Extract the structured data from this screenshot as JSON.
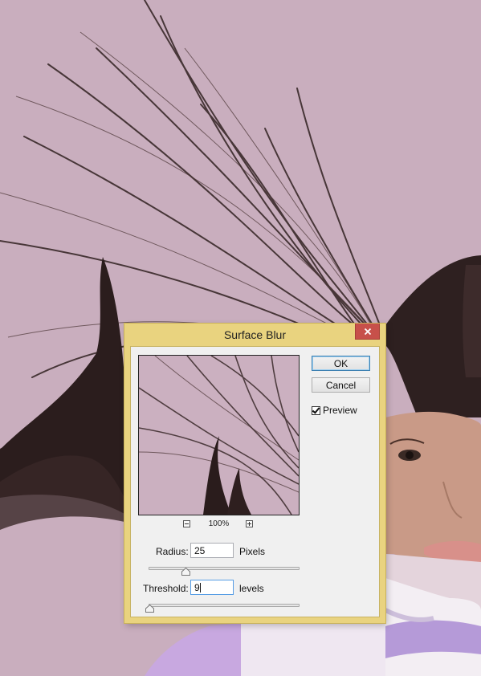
{
  "dialog": {
    "title": "Surface Blur",
    "close_icon": "close-icon",
    "ok_label": "OK",
    "cancel_label": "Cancel",
    "preview_label": "Preview",
    "preview_checked": true,
    "zoom_level": "100%",
    "radius": {
      "label": "Radius:",
      "value": "25",
      "unit": "Pixels",
      "slider_fraction": 0.24
    },
    "threshold": {
      "label": "Threshold:",
      "value": "9",
      "unit": "levels",
      "slider_fraction": 0.0
    }
  },
  "colors": {
    "title_bar": "#e9d37f",
    "close_button": "#c7504a",
    "background": "#c9aebe",
    "hair": "#2a1c1c"
  },
  "icons": [
    "close-icon",
    "zoom-out-icon",
    "zoom-in-icon",
    "checkmark-icon",
    "slider-thumb-icon"
  ]
}
